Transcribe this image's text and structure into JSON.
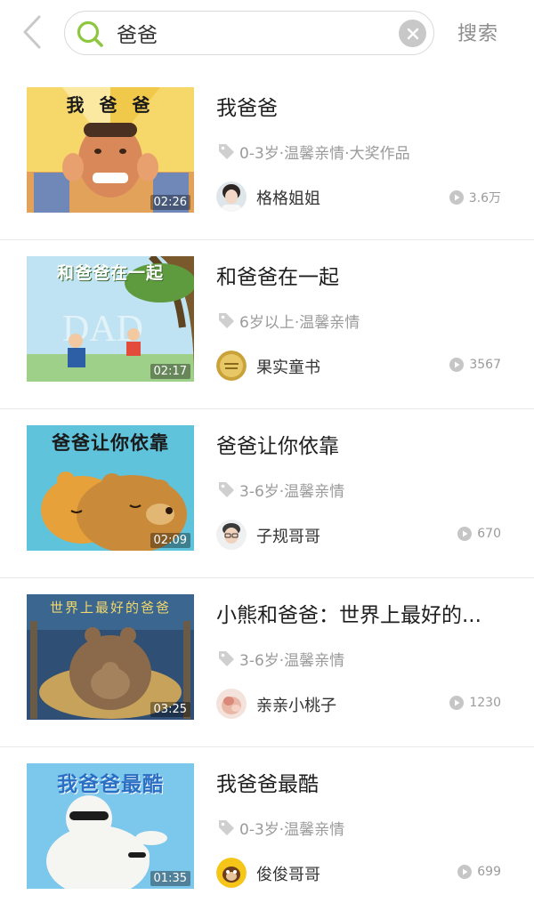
{
  "header": {
    "search_value": "爸爸",
    "search_button_label": "搜索"
  },
  "colors": {
    "accent": "#8dc63f",
    "muted_text": "#9b9b9b",
    "divider": "#e8e8e8"
  },
  "icons": {
    "back": "chevron-left-icon",
    "search": "search-icon",
    "clear": "clear-icon",
    "tag": "tag-icon",
    "plays": "play-icon"
  },
  "results": [
    {
      "title": "我爸爸",
      "cover_text": "我 爸 爸",
      "duration": "02:26",
      "tags": "0-3岁·温馨亲情·大奖作品",
      "author": "格格姐姐",
      "plays": "3.6万"
    },
    {
      "title": "和爸爸在一起",
      "cover_text": "和爸爸在一起",
      "duration": "02:17",
      "tags": "6岁以上·温馨亲情",
      "author": "果实童书",
      "plays": "3567"
    },
    {
      "title": "爸爸让你依靠",
      "cover_text": "爸爸让你依靠",
      "duration": "02:09",
      "tags": "3-6岁·温馨亲情",
      "author": "子规哥哥",
      "plays": "670"
    },
    {
      "title": "小熊和爸爸：世界上最好的...",
      "cover_text": "世界上最好的爸爸",
      "duration": "03:25",
      "tags": "3-6岁·温馨亲情",
      "author": "亲亲小桃子",
      "plays": "1230"
    },
    {
      "title": "我爸爸最酷",
      "cover_text": "我爸爸最酷",
      "duration": "01:35",
      "tags": "0-3岁·温馨亲情",
      "author": "俊俊哥哥",
      "plays": "699"
    }
  ]
}
